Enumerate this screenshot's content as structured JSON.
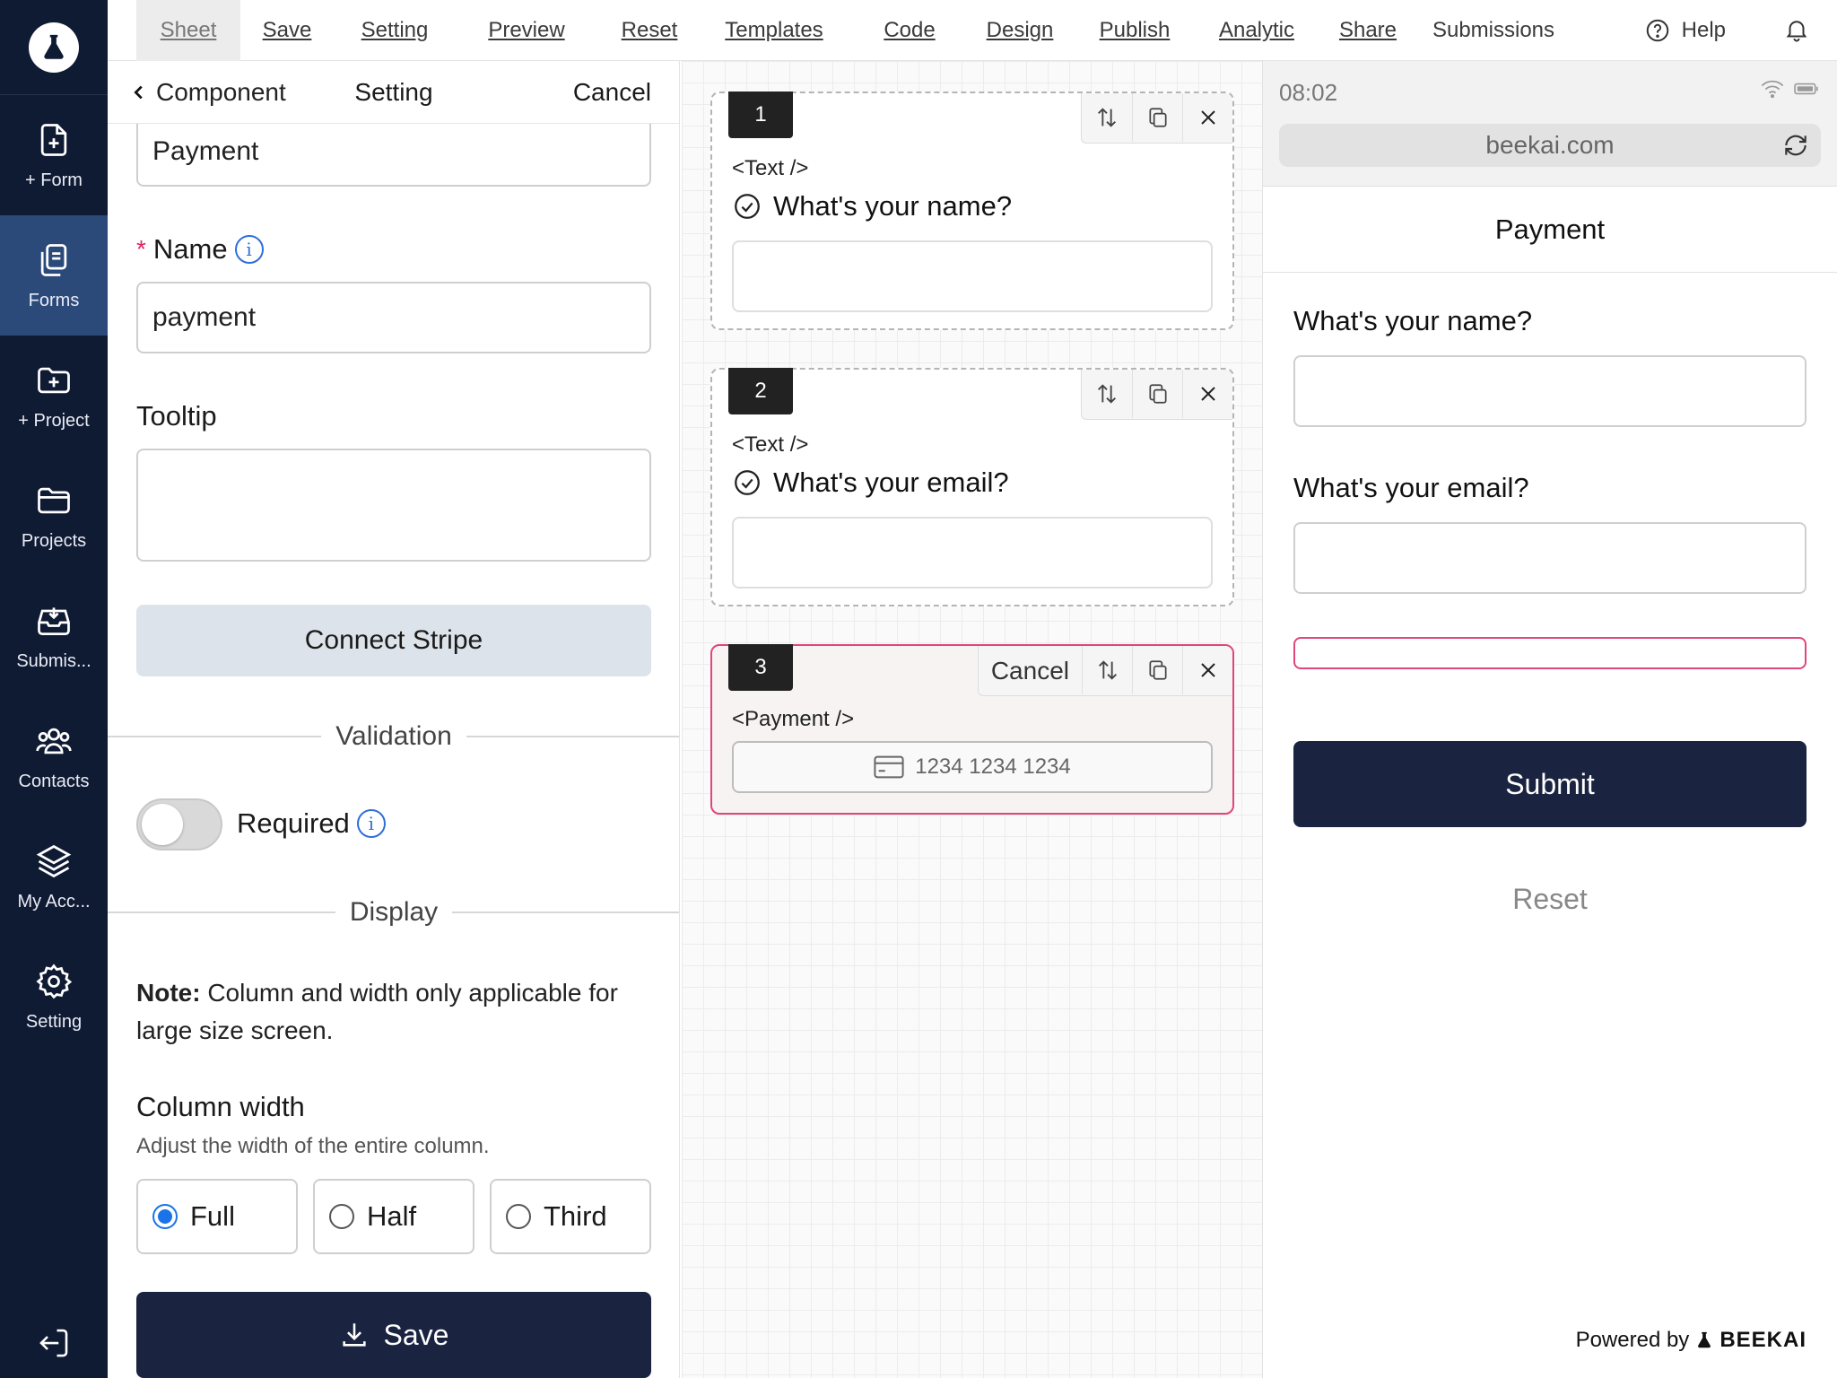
{
  "sidebar": {
    "items": [
      {
        "label": "+ Form",
        "icon": "file-plus-icon"
      },
      {
        "label": "Forms",
        "icon": "forms-icon"
      },
      {
        "label": "+ Project",
        "icon": "folder-plus-icon"
      },
      {
        "label": "Projects",
        "icon": "folder-icon"
      },
      {
        "label": "Submis...",
        "icon": "inbox-icon"
      },
      {
        "label": "Contacts",
        "icon": "users-icon"
      },
      {
        "label": "My Acc...",
        "icon": "layers-icon"
      },
      {
        "label": "Setting",
        "icon": "gear-icon"
      }
    ]
  },
  "menu": {
    "sheet": "Sheet",
    "save": "Save",
    "setting": "Setting",
    "preview": "Preview",
    "reset": "Reset",
    "templates": "Templates",
    "code": "Code",
    "design": "Design",
    "publish": "Publish",
    "analytic": "Analytic",
    "share": "Share",
    "submissions": "Submissions",
    "help": "Help"
  },
  "settings": {
    "back_label": "Component",
    "title": "Setting",
    "cancel": "Cancel",
    "label_value": "Payment",
    "name_label": "Name",
    "name_value": "payment",
    "tooltip_label": "Tooltip",
    "tooltip_value": "",
    "connect_stripe": "Connect Stripe",
    "validation_heading": "Validation",
    "required_label": "Required",
    "required_on": false,
    "display_heading": "Display",
    "note_bold": "Note:",
    "note_text": " Column and width only applicable for large size screen.",
    "column_width_title": "Column width",
    "column_width_sub": "Adjust the width of the entire column.",
    "width_options": [
      "Full",
      "Half",
      "Third"
    ],
    "width_selected": "Full",
    "save_label": "Save"
  },
  "canvas": {
    "cards": [
      {
        "num": "1",
        "tag": "<Text />",
        "question": "What's your name?"
      },
      {
        "num": "2",
        "tag": "<Text />",
        "question": "What's your email?"
      },
      {
        "num": "3",
        "tag": "<Payment />",
        "cancel": "Cancel",
        "card_placeholder": "1234 1234 1234"
      }
    ]
  },
  "preview": {
    "time": "08:02",
    "url": "beekai.com",
    "form_title": "Payment",
    "q1": "What's your name?",
    "q2": "What's your email?",
    "submit": "Submit",
    "reset": "Reset",
    "powered_by": "Powered by",
    "brand": "BEEKAI"
  },
  "colors": {
    "sidebar_bg": "#0f1a33",
    "sidebar_active": "#2b4a7a",
    "primary_button": "#1a2440",
    "selected_border": "#e0457b",
    "info_blue": "#2f6fd8"
  }
}
